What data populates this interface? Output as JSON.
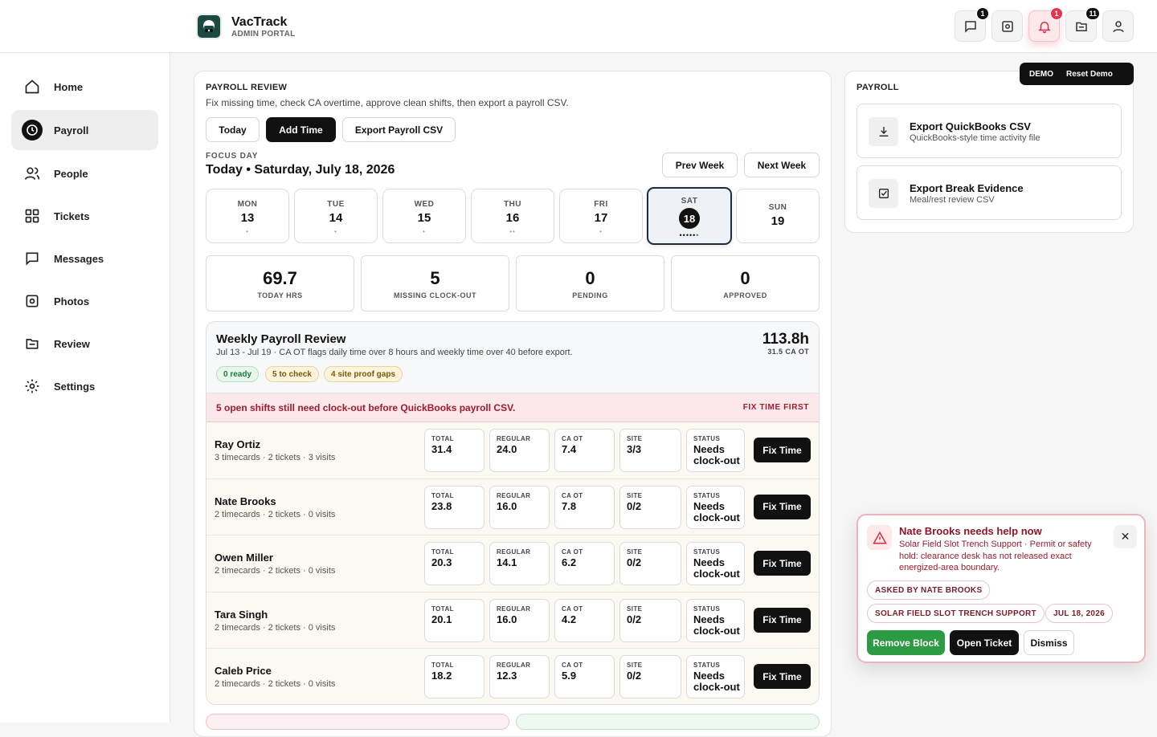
{
  "app": {
    "name": "VacTrack",
    "subtitle": "ADMIN PORTAL"
  },
  "topbar": {
    "icons": [
      {
        "name": "messages-icon",
        "badge": "1"
      },
      {
        "name": "photo-icon",
        "badge": ""
      },
      {
        "name": "bell-icon",
        "badge": "1"
      },
      {
        "name": "review-icon",
        "badge": "11"
      },
      {
        "name": "user-icon",
        "badge": ""
      }
    ]
  },
  "sidebar": {
    "items": [
      {
        "label": "Home",
        "icon": "home-icon"
      },
      {
        "label": "Payroll",
        "icon": "clock-icon",
        "active": true
      },
      {
        "label": "People",
        "icon": "people-icon"
      },
      {
        "label": "Tickets",
        "icon": "grid-icon"
      },
      {
        "label": "Messages",
        "icon": "chat-icon"
      },
      {
        "label": "Photos",
        "icon": "photo-icon"
      },
      {
        "label": "Review",
        "icon": "folder-icon"
      },
      {
        "label": "Settings",
        "icon": "gear-icon"
      }
    ]
  },
  "main": {
    "section_title": "PAYROLL REVIEW",
    "instructions": "Fix missing time, check CA overtime, approve clean shifts, then export a payroll CSV.",
    "buttons": {
      "today": "Today",
      "add_time": "Add Time",
      "export": "Export Payroll CSV",
      "prev_week": "Prev Week",
      "next_week": "Next Week"
    },
    "focus_label": "FOCUS DAY",
    "focus_date": "Today • Saturday, July 18, 2026",
    "days": [
      {
        "name": "MON",
        "num": "13",
        "dots": "•"
      },
      {
        "name": "TUE",
        "num": "14",
        "dots": "•"
      },
      {
        "name": "WED",
        "num": "15",
        "dots": "•"
      },
      {
        "name": "THU",
        "num": "16",
        "dots": "••"
      },
      {
        "name": "FRI",
        "num": "17",
        "dots": "•"
      },
      {
        "name": "SAT",
        "num": "18",
        "dots": "••••••",
        "selected": true
      },
      {
        "name": "SUN",
        "num": "19",
        "dots": ""
      }
    ],
    "stats": [
      {
        "value": "69.7",
        "label": "TODAY HRS"
      },
      {
        "value": "5",
        "label": "MISSING CLOCK-OUT"
      },
      {
        "value": "0",
        "label": "PENDING"
      },
      {
        "value": "0",
        "label": "APPROVED"
      }
    ],
    "weekly": {
      "title": "Weekly Payroll Review",
      "subtitle": "Jul 13 - Jul 19 · CA OT flags daily time over 8 hours and weekly time over 40 before export.",
      "total": "113.8h",
      "ca_ot": "31.5 CA OT",
      "pills": {
        "ready": "0 ready",
        "check": "5 to check",
        "gaps": "4 site proof gaps"
      },
      "warning": "5 open shifts still need clock-out before QuickBooks payroll CSV.",
      "warning_action": "FIX TIME FIRST",
      "col_labels": {
        "total": "TOTAL",
        "regular": "REGULAR",
        "caot": "CA OT",
        "site": "SITE",
        "status": "STATUS"
      },
      "fix_label": "Fix Time",
      "rows": [
        {
          "name": "Ray Ortiz",
          "meta": "3 timecards · 2 tickets · 3 visits",
          "total": "31.4",
          "regular": "24.0",
          "caot": "7.4",
          "site": "3/3",
          "status": "Needs clock-out"
        },
        {
          "name": "Nate Brooks",
          "meta": "2 timecards · 2 tickets · 0 visits",
          "total": "23.8",
          "regular": "16.0",
          "caot": "7.8",
          "site": "0/2",
          "status": "Needs clock-out"
        },
        {
          "name": "Owen Miller",
          "meta": "2 timecards · 2 tickets · 0 visits",
          "total": "20.3",
          "regular": "14.1",
          "caot": "6.2",
          "site": "0/2",
          "status": "Needs clock-out"
        },
        {
          "name": "Tara Singh",
          "meta": "2 timecards · 2 tickets · 0 visits",
          "total": "20.1",
          "regular": "16.0",
          "caot": "4.2",
          "site": "0/2",
          "status": "Needs clock-out"
        },
        {
          "name": "Caleb Price",
          "meta": "2 timecards · 2 tickets · 0 visits",
          "total": "18.2",
          "regular": "12.3",
          "caot": "5.9",
          "site": "0/2",
          "status": "Needs clock-out"
        }
      ]
    }
  },
  "right": {
    "title": "PAYROLL",
    "demo": {
      "label": "DEMO",
      "reset": "Reset Demo"
    },
    "exports": [
      {
        "title": "Export QuickBooks CSV",
        "subtitle": "QuickBooks-style time activity file",
        "icon": "download-icon"
      },
      {
        "title": "Export Break Evidence",
        "subtitle": "Meal/rest review CSV",
        "icon": "checkbox-icon"
      }
    ]
  },
  "toast": {
    "title": "Nate Brooks needs help now",
    "body": "Solar Field Slot Trench Support · Permit or safety hold: clearance desk has not released exact energized-area boundary.",
    "tags": {
      "asked": "ASKED BY NATE BROOKS",
      "ticket": "SOLAR FIELD SLOT TRENCH SUPPORT",
      "date": "JUL 18, 2026"
    },
    "buttons": {
      "remove": "Remove Block",
      "open": "Open Ticket",
      "dismiss": "Dismiss"
    }
  }
}
